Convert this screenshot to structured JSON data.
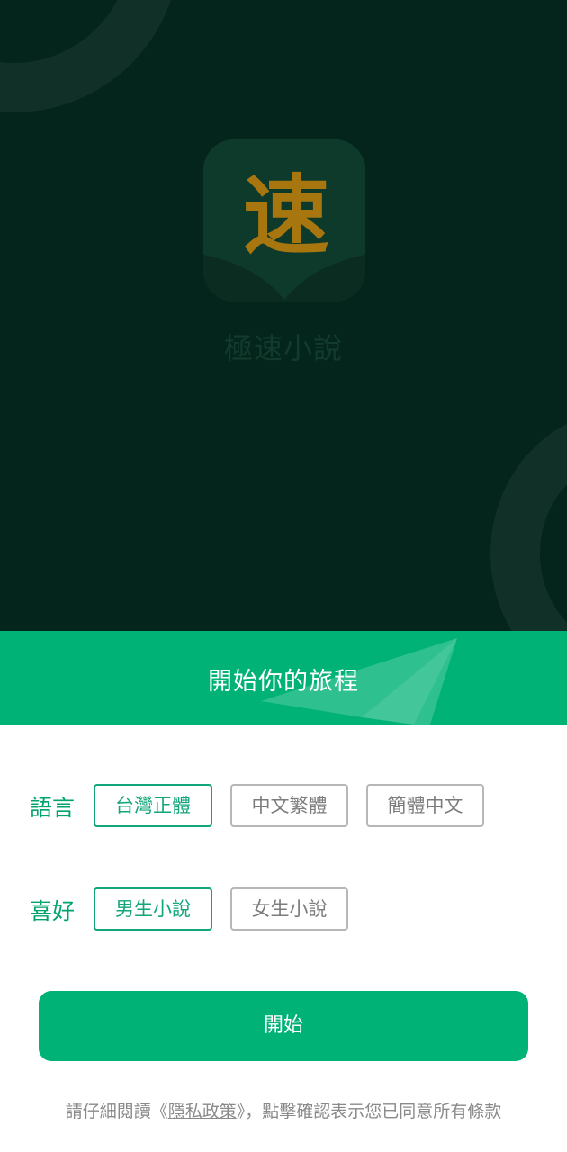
{
  "splash": {
    "app_icon_glyph": "速",
    "app_name": "極速小說"
  },
  "banner": {
    "title": "開始你的旅程"
  },
  "language": {
    "label": "語言",
    "options": [
      "台灣正體",
      "中文繁體",
      "簡體中文"
    ],
    "selected": "台灣正體"
  },
  "preference": {
    "label": "喜好",
    "options": [
      "男生小說",
      "女生小說"
    ],
    "selected": "男生小說"
  },
  "start_button": {
    "label": "開始"
  },
  "privacy": {
    "prefix": "請仔細閱讀《",
    "link": "隱私政策",
    "suffix": "》，點擊確認表示您已同意所有條款"
  },
  "colors": {
    "splash_background": "#03251b",
    "accent_green": "#00b276",
    "selected_chip": "#12a67a",
    "app_icon_glyph": "#b07a12"
  }
}
